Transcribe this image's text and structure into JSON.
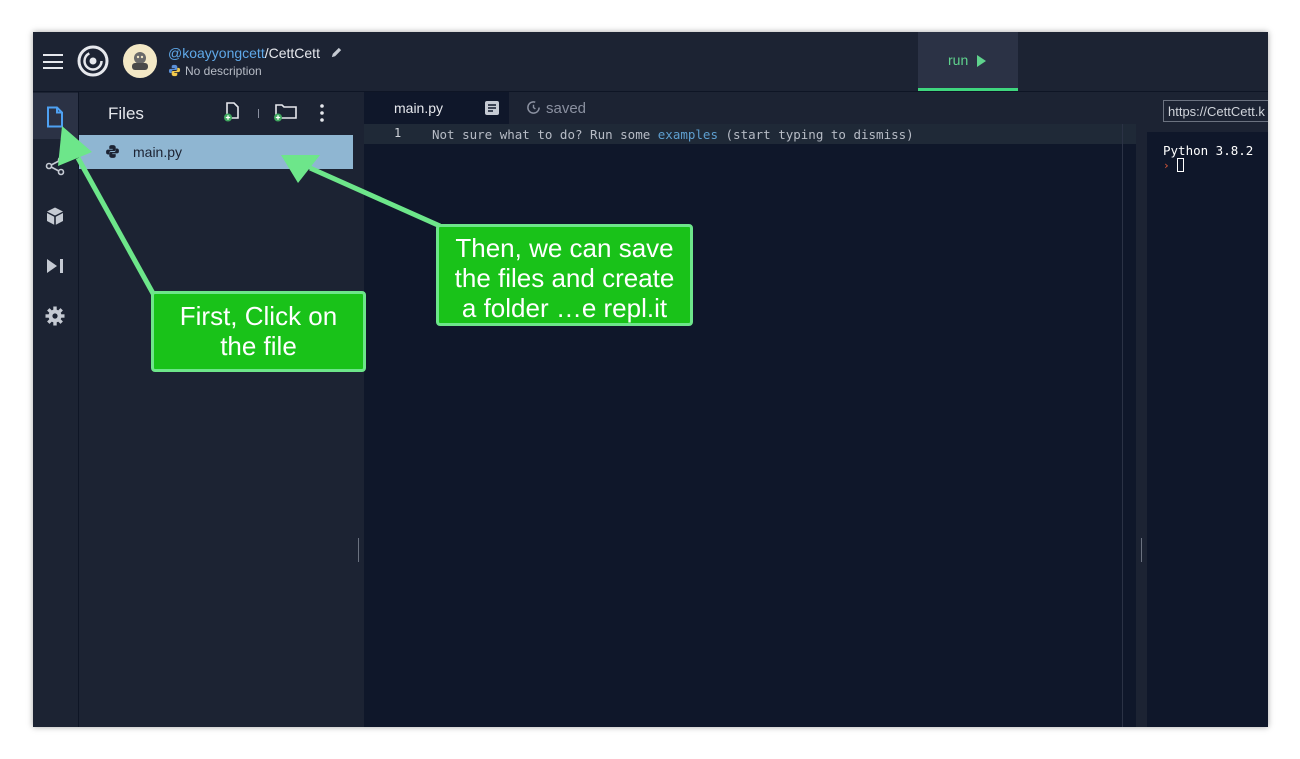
{
  "topbar": {
    "username": "@koayyongcett",
    "separator": "/",
    "repl_name": "CettCett",
    "description": "No description",
    "run_label": "run",
    "icons": [
      "menu-icon",
      "replit-logo",
      "avatar",
      "pencil-icon",
      "python-icon",
      "play-icon"
    ]
  },
  "sidebar": {
    "icons": [
      "file-icon",
      "share-icon",
      "package-icon",
      "debugger-icon",
      "settings-icon"
    ]
  },
  "files_panel": {
    "title": "Files",
    "files": [
      {
        "name": "main.py",
        "icon": "python-icon"
      }
    ],
    "icons": [
      "add-file-icon",
      "add-folder-icon",
      "more-vertical-icon"
    ]
  },
  "editor": {
    "tab_name": "main.py",
    "save_status": "saved",
    "line_number": "1",
    "hint_before": "Not sure what to do? Run some ",
    "hint_link": "examples",
    "hint_after": " (start typing to dismiss)"
  },
  "console": {
    "url": "https://CettCett.k",
    "python_version": "Python 3.8.2",
    "prompt": "›"
  },
  "annotations": {
    "callout_1": [
      "First, Click on",
      "the file"
    ],
    "callout_2": [
      "Then, we can save",
      "the files and create",
      "a folder …e repl.it"
    ],
    "callout_color": "#19c219",
    "arrow_color": "#6de68a"
  },
  "colors": {
    "background": "#1c2333",
    "editor_bg": "#0f172a",
    "selected_file": "#8fb6d2",
    "run_accent": "#5fd38d",
    "link": "#5e9fd0"
  }
}
